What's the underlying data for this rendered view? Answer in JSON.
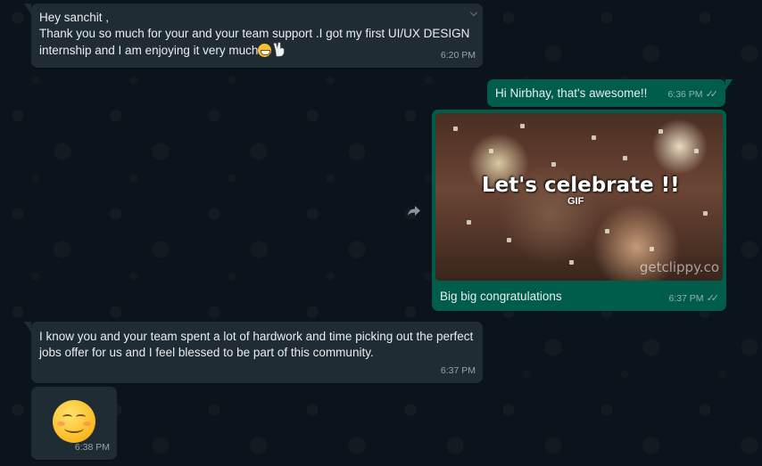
{
  "colors": {
    "background": "#0b141a",
    "incoming_bubble": "#202c33",
    "outgoing_bubble": "#005c4b",
    "text": "#e9edef"
  },
  "messages": [
    {
      "direction": "incoming",
      "text": "Hey sanchit ,\nThank you so much for your and your team support .I got my first UI/UX DESIGN internship and I am enjoying it very much",
      "emojis": [
        "grinning-face",
        "victory-hand"
      ],
      "time": "6:20 PM"
    },
    {
      "direction": "outgoing",
      "text": "Hi Nirbhay, that's awesome!!",
      "time": "6:36 PM",
      "status": "read"
    },
    {
      "direction": "outgoing",
      "type": "gif",
      "gif_headline": "Let's celebrate !!",
      "gif_badge": "GIF",
      "gif_watermark": "getclippy.co",
      "caption": "Big big congratulations",
      "time": "6:37 PM",
      "status": "read"
    },
    {
      "direction": "incoming",
      "text": "I know you and your team spent a lot of hardwork and  time picking out the perfect jobs offer for us and I feel blessed to be part of this  community.",
      "time": "6:37 PM"
    },
    {
      "direction": "incoming",
      "type": "emoji",
      "emoji": "smiling-face-with-smiling-eyes",
      "time": "6:38 PM"
    }
  ],
  "icons": {
    "forward": "forward-arrow-icon",
    "read_receipt": "double-check-icon",
    "menu": "chevron-down-icon"
  }
}
